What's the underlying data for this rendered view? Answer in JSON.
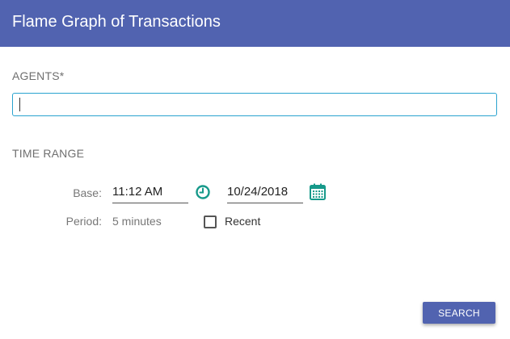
{
  "header": {
    "title": "Flame Graph of Transactions"
  },
  "agents": {
    "label": "AGENTS*",
    "value": ""
  },
  "time_range": {
    "label": "TIME RANGE",
    "base_label": "Base:",
    "time_value": "11:12 AM",
    "date_value": "10/24/2018",
    "period_label": "Period:",
    "period_value": "5 minutes",
    "recent_label": "Recent",
    "recent_checked": false
  },
  "actions": {
    "search_label": "SEARCH"
  },
  "icons": {
    "time": "clock-icon",
    "date": "calendar-icon"
  },
  "colors": {
    "primary": "#5163b0",
    "input_focus": "#2aa3cf",
    "icon_teal": "#16998a"
  }
}
